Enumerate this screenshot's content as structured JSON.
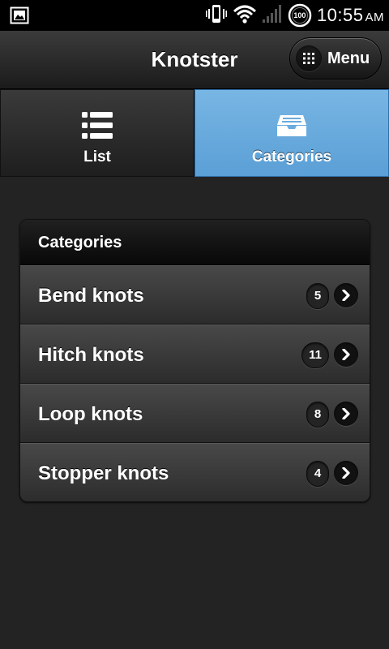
{
  "status_bar": {
    "time": "10:55",
    "ampm": "AM",
    "battery_level": "100",
    "icons": [
      "image-icon",
      "vibrate-icon",
      "wifi-icon",
      "signal-icon",
      "battery-icon"
    ]
  },
  "header": {
    "title": "Knotster",
    "menu_label": "Menu"
  },
  "tabs": [
    {
      "label": "List",
      "icon": "list-icon",
      "active": false
    },
    {
      "label": "Categories",
      "icon": "inbox-icon",
      "active": true
    }
  ],
  "categories": {
    "header": "Categories",
    "items": [
      {
        "label": "Bend knots",
        "count": "5"
      },
      {
        "label": "Hitch knots",
        "count": "11"
      },
      {
        "label": "Loop knots",
        "count": "8"
      },
      {
        "label": "Stopper knots",
        "count": "4"
      }
    ]
  },
  "colors": {
    "active_tab": "#6aaadc",
    "background": "#232323"
  }
}
